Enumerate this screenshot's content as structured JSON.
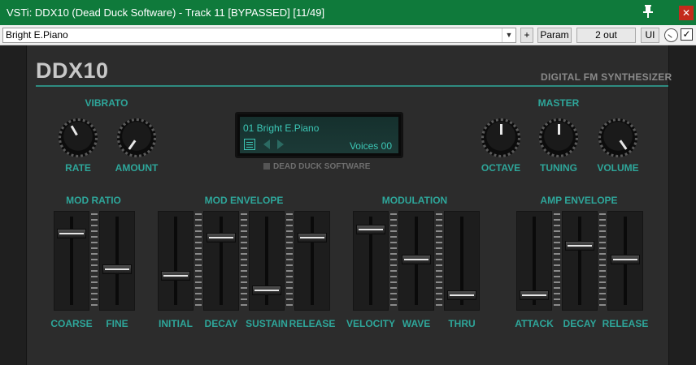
{
  "window": {
    "title": "VSTi: DDX10 (Dead Duck Software) - Track 11 [BYPASSED] [11/49]",
    "close_glyph": "✕"
  },
  "toolbar": {
    "preset_value": "Bright E.Piano",
    "plus_label": "+",
    "param_label": "Param",
    "out_label": "2 out",
    "ui_label": "UI",
    "checkbox_checked": true
  },
  "plugin": {
    "brand": "DDX10",
    "subtitle": "DIGITAL FM SYNTHESIZER",
    "company": "DEAD DUCK SOFTWARE",
    "accent_color": "#2ea69a"
  },
  "display": {
    "preset": "01  Bright E.Piano",
    "voices": "Voices 00"
  },
  "sections": {
    "vibrato": "VIBRATO",
    "master": "MASTER",
    "mod_ratio": "MOD RATIO",
    "mod_envelope": "MOD ENVELOPE",
    "modulation": "MODULATION",
    "amp_envelope": "AMP ENVELOPE"
  },
  "knobs": {
    "rate": {
      "label": "RATE",
      "angle": -30
    },
    "amount": {
      "label": "AMOUNT",
      "angle": -145
    },
    "octave": {
      "label": "OCTAVE",
      "angle": 0
    },
    "tuning": {
      "label": "TUNING",
      "angle": 0
    },
    "volume": {
      "label": "VOLUME",
      "angle": 145
    }
  },
  "sliders": {
    "coarse": {
      "label": "COARSE",
      "level": 0.85
    },
    "fine": {
      "label": "FINE",
      "level": 0.36
    },
    "initial": {
      "label": "INITIAL",
      "level": 0.27
    },
    "decay": {
      "label": "DECAY",
      "level": 0.8
    },
    "sustain": {
      "label": "SUSTAIN",
      "level": 0.07
    },
    "release": {
      "label": "RELEASE",
      "level": 0.8
    },
    "velocity": {
      "label": "VELOCITY",
      "level": 0.91
    },
    "wave": {
      "label": "WAVE",
      "level": 0.5
    },
    "thru": {
      "label": "THRU",
      "level": 0.0
    },
    "attack": {
      "label": "ATTACK",
      "level": 0.0
    },
    "amp_decay": {
      "label": "DECAY",
      "level": 0.69
    },
    "amp_release": {
      "label": "RELEASE",
      "level": 0.5
    }
  }
}
